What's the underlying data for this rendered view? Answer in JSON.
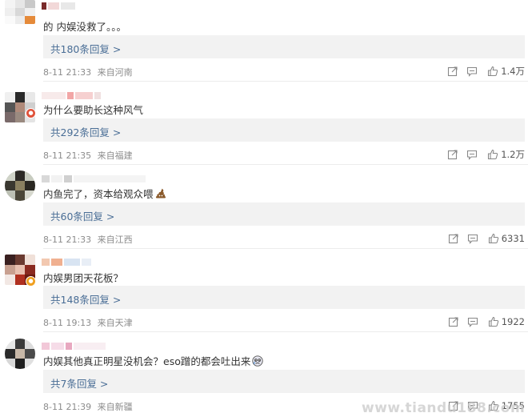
{
  "comments": [
    {
      "text": "的 内娱没救了。。。",
      "reply": "共180条回复 >",
      "time": "8-11 21:33",
      "location": "来自河南",
      "likes": "1.4万",
      "verified": false
    },
    {
      "text": "为什么要助长这种风气",
      "reply": "共292条回复 >",
      "time": "8-11 21:35",
      "location": "来自福建",
      "likes": "1.2万",
      "verified": true
    },
    {
      "text": "内鱼完了，资本给观众喂",
      "reply": "共60条回复 >",
      "time": "8-11 21:33",
      "location": "来自江西",
      "likes": "6331",
      "verified": false
    },
    {
      "text": "内娱男团天花板？",
      "reply": "共148条回复 >",
      "time": "8-11 19:13",
      "location": "来自天津",
      "likes": "1922",
      "verified": true
    },
    {
      "text": "内娱其他真正明星没机会？eso蹭的都会吐出来",
      "reply": "共7条回复 >",
      "time": "8-11 21:39",
      "location": "来自新疆",
      "likes": "1755",
      "verified": false
    }
  ],
  "watermark": "www.tiandu188.com",
  "icons": [
    "share-icon",
    "comment-icon",
    "like-icon",
    "poop-emoji",
    "crying-face-emoji"
  ],
  "colors": {
    "reply_link": "#4a6e96",
    "reply_bg": "#f2f2f2",
    "meta": "#8c8c8c",
    "badge": "#e0523a"
  }
}
